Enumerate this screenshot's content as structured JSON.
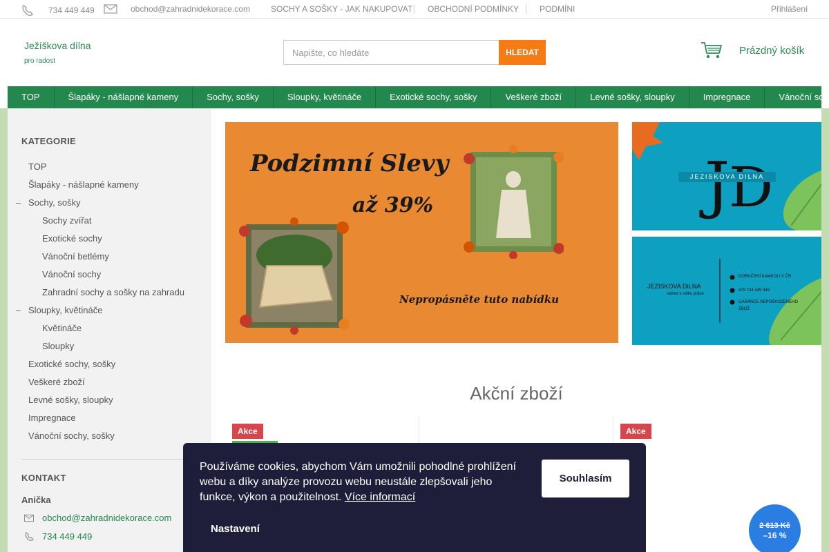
{
  "topbar": {
    "phone": "734 449 449",
    "email": "obchod@zahradnidekorace.com",
    "links": [
      "SOCHY A SOŠKY - JAK NAKUPOVAT",
      "OBCHODNÍ PODMÍNKY",
      "PODMÍNI"
    ],
    "login": "Přihlášení"
  },
  "header": {
    "logo_title": "Ježíškova dílna",
    "logo_sub": "pro radost",
    "search_placeholder": "Napište, co hledáte",
    "search_button": "HLEDAT",
    "cart_label": "Prázdný košík"
  },
  "nav": [
    "TOP",
    "Šlapáky - nášlapné kameny",
    "Sochy, sošky",
    "Sloupky, květináče",
    "Exotické sochy, sošky",
    "Veškeré zboží",
    "Levné sošky, sloupky",
    "Impregnace",
    "Vánoční sochy, sošky"
  ],
  "sidebar": {
    "categories_title": "KATEGORIE",
    "categories": [
      {
        "label": "TOP",
        "level": 0,
        "expanded": false
      },
      {
        "label": "Šlapáky - nášlapné kameny",
        "level": 0,
        "expanded": false
      },
      {
        "label": "Sochy, sošky",
        "level": 0,
        "expanded": true
      },
      {
        "label": "Sochy zvířat",
        "level": 1,
        "expanded": false
      },
      {
        "label": "Exotické sochy",
        "level": 1,
        "expanded": false
      },
      {
        "label": "Vánoční betlémy",
        "level": 1,
        "expanded": false
      },
      {
        "label": "Vánoční sochy",
        "level": 1,
        "expanded": false
      },
      {
        "label": "Zahradní sochy a sošky na zahradu",
        "level": 1,
        "expanded": false
      },
      {
        "label": "Sloupky, květináče",
        "level": 0,
        "expanded": true
      },
      {
        "label": "Květináče",
        "level": 1,
        "expanded": false
      },
      {
        "label": "Sloupky",
        "level": 1,
        "expanded": false
      },
      {
        "label": "Exotické sochy, sošky",
        "level": 0,
        "expanded": false
      },
      {
        "label": "Veškeré zboží",
        "level": 0,
        "expanded": false
      },
      {
        "label": "Levné sošky, sloupky",
        "level": 0,
        "expanded": false
      },
      {
        "label": "Impregnace",
        "level": 0,
        "expanded": false
      },
      {
        "label": "Vánoční sochy, sošky",
        "level": 0,
        "expanded": false
      }
    ],
    "expand_marker": "–",
    "contact_title": "KONTAKT",
    "contact_name": "Anička",
    "contact_email": "obchod@zahradnidekorace.com",
    "contact_phone": "734 449 449"
  },
  "banners": {
    "main_title": "Podzimní Slevy",
    "main_discount": "až 39%",
    "main_footer": "Nepropásněte tuto nabídku",
    "logo_text": "JEZISKOVA DILNA",
    "card_name": "JEZISKOVA DILNA",
    "card_sub": "radost v celku práce",
    "card_lines": [
      "DORUČENÍ KAMKOLI V ČR",
      "479 734 449 449",
      "GARANCE NEPOŠKOZENÉHO",
      "ZBOŽ"
    ]
  },
  "sale_section": {
    "title": "Akční zboží",
    "badges": [
      "Akce",
      "Akce"
    ],
    "price_old": "2 613 Kč",
    "price_discount": "–16 %"
  },
  "cookie": {
    "text": "Používáme cookies, abychom Vám umožnili pohodlné prohlížení webu a díky analýze provozu webu neustále zlepšovali jeho funkce, výkon a použitelnost.",
    "more_link": "Více informací",
    "accept": "Souhlasím",
    "settings": "Nastavení"
  },
  "colors": {
    "brand_green": "#23884e",
    "accent_orange": "#f57c13",
    "sale_red": "#d8454a",
    "frame_green": "#c3dcb2",
    "cookie_bg": "#1e1e3a"
  }
}
